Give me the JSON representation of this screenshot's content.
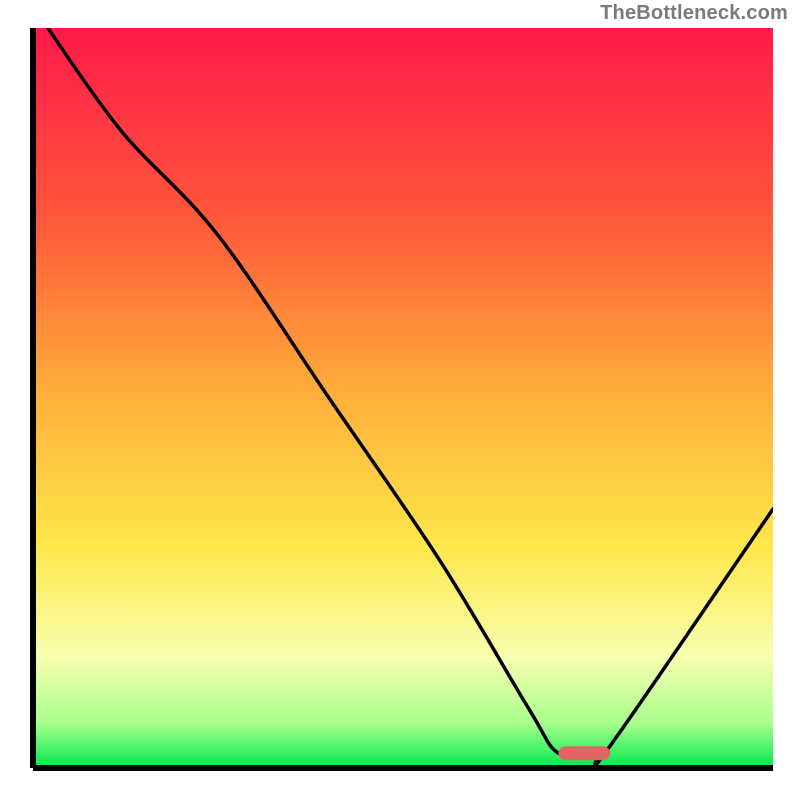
{
  "watermark": "TheBottleneck.com",
  "chart_data": {
    "type": "line",
    "title": "",
    "xlabel": "",
    "ylabel": "",
    "xlim": [
      0,
      100
    ],
    "ylim": [
      0,
      100
    ],
    "grid": false,
    "series": [
      {
        "name": "curve",
        "x": [
          2,
          12,
          25,
          40,
          55,
          67,
          71,
          76,
          78,
          100
        ],
        "y": [
          100,
          86,
          72,
          50,
          28,
          8,
          2,
          2,
          3,
          35
        ]
      }
    ],
    "marker": {
      "name": "highlight-bar",
      "x_range": [
        71,
        78
      ],
      "y": 2,
      "color": "#e06666"
    },
    "gradient_stops": [
      {
        "position": 0,
        "color": "#ff1a4b"
      },
      {
        "position": 25,
        "color": "#ff553a"
      },
      {
        "position": 50,
        "color": "#ffb03a"
      },
      {
        "position": 70,
        "color": "#ffe74a"
      },
      {
        "position": 85,
        "color": "#f8ffb0"
      },
      {
        "position": 94,
        "color": "#a7ff8c"
      },
      {
        "position": 100,
        "color": "#00e84e"
      }
    ],
    "axis_color": "#000000"
  }
}
